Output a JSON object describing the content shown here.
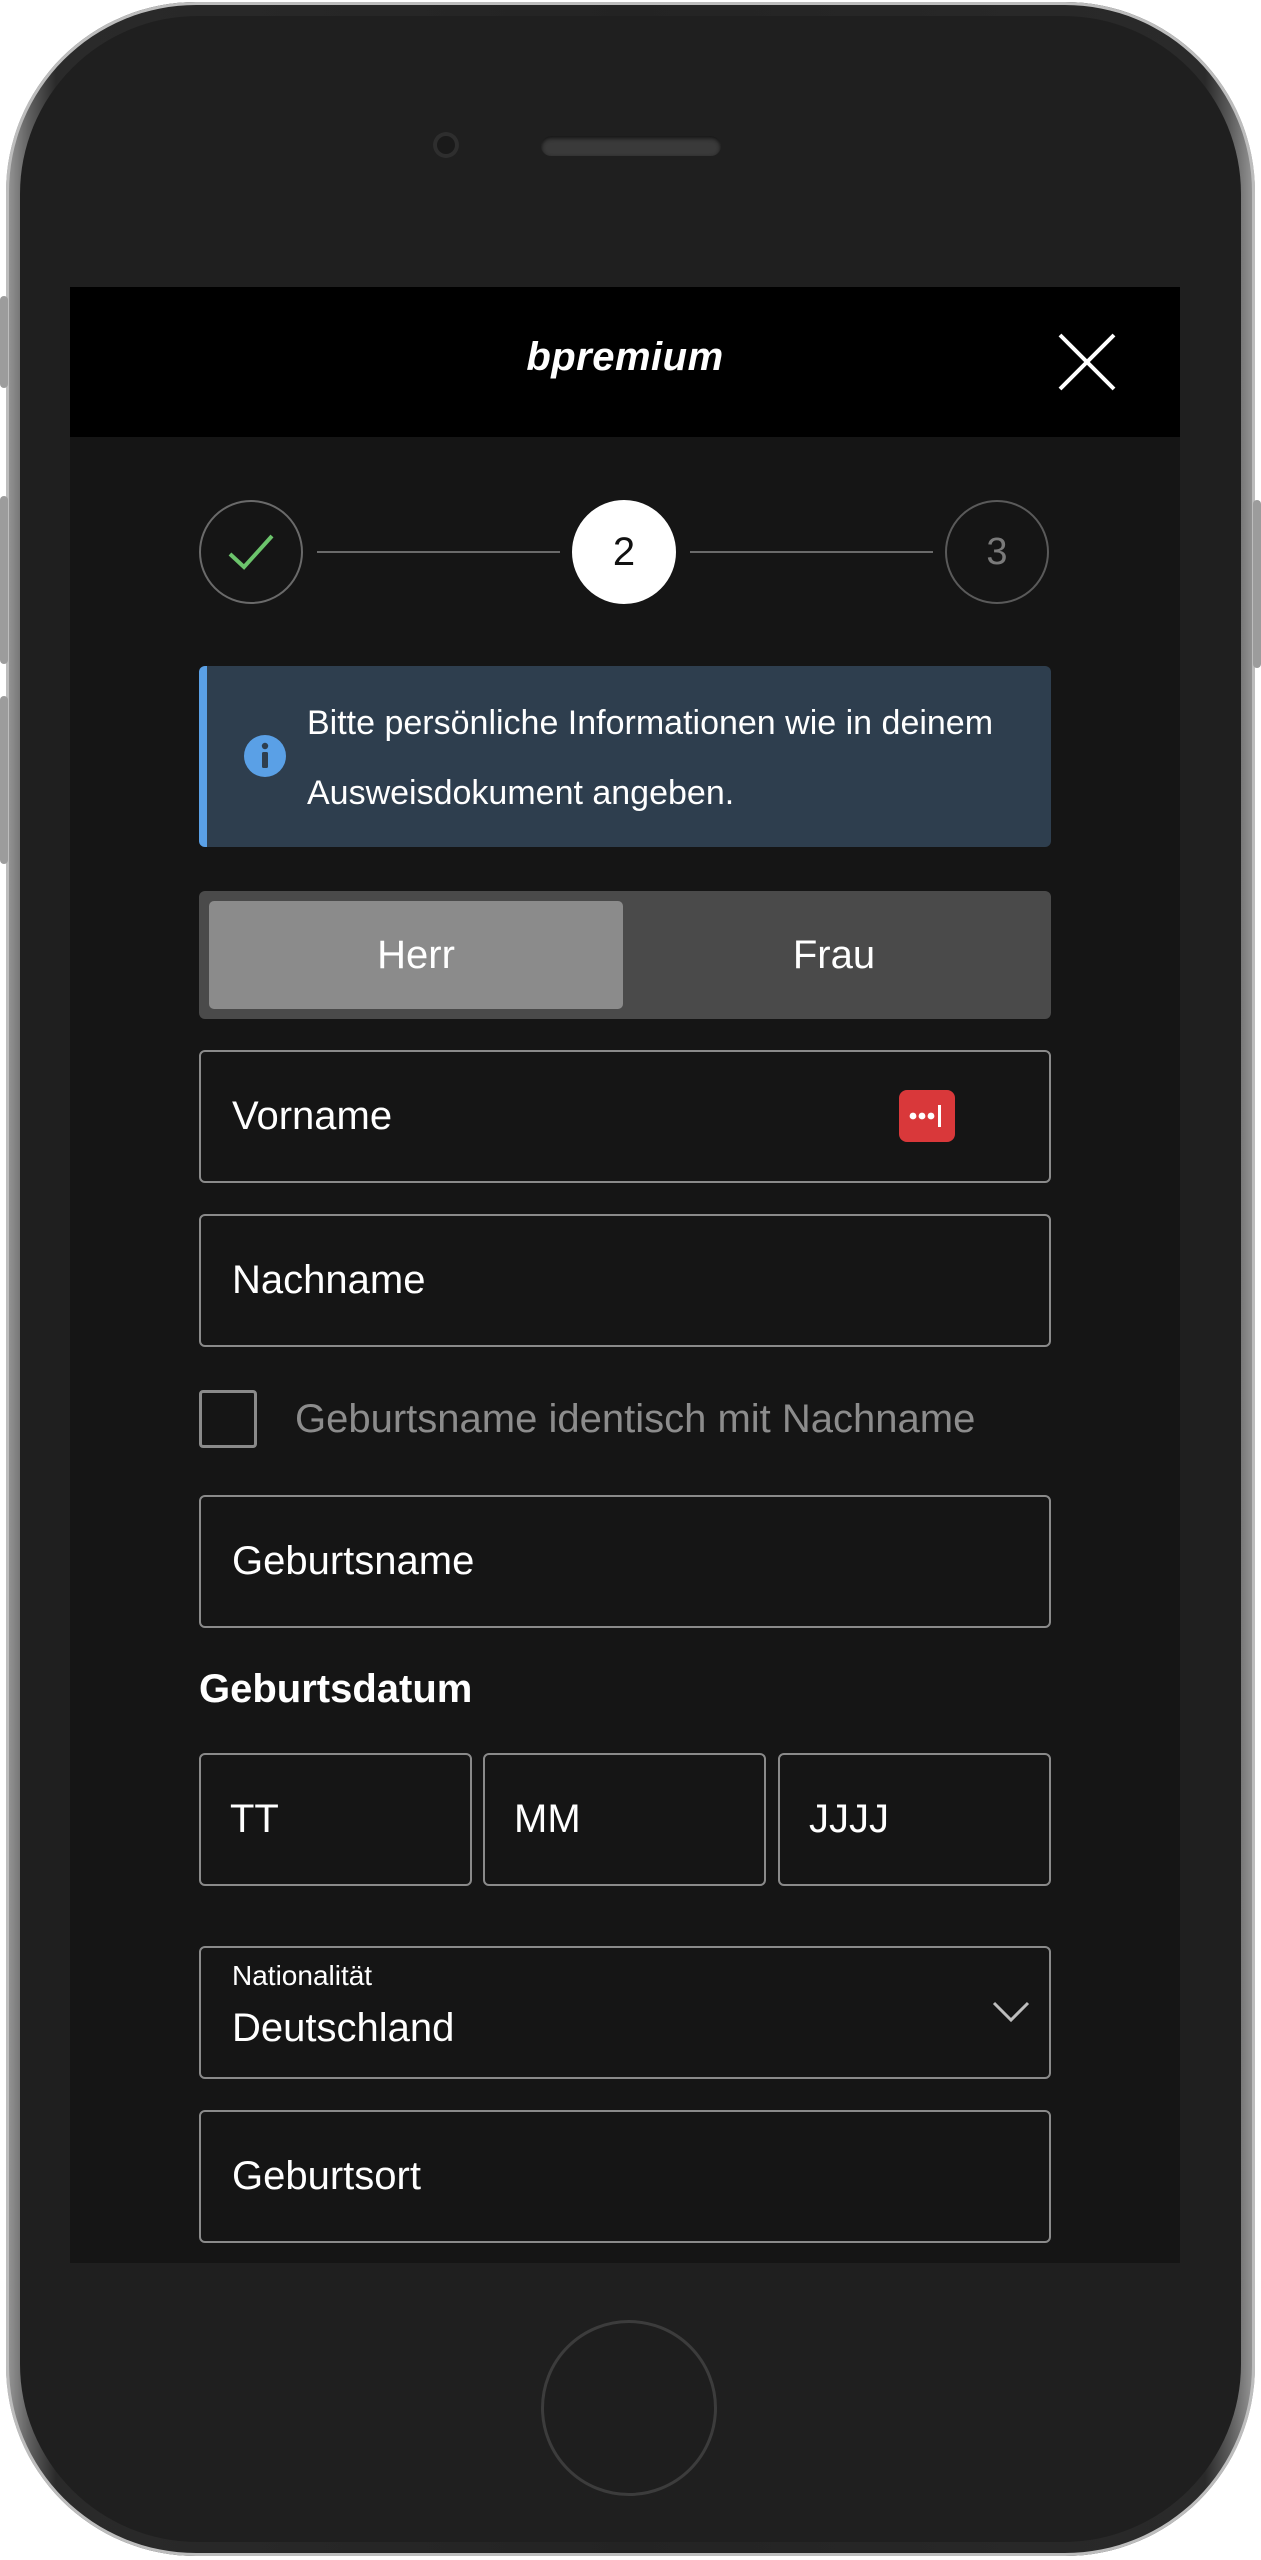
{
  "app": {
    "brand": "bpremium"
  },
  "steps": [
    {
      "status": "done",
      "label": ""
    },
    {
      "status": "active",
      "label": "2"
    },
    {
      "status": "todo",
      "label": "3"
    }
  ],
  "info": {
    "text": "Bitte persönliche Informationen wie in deinem Ausweisdokument angeben."
  },
  "gender": {
    "options": [
      "Herr",
      "Frau"
    ],
    "selected": "Herr"
  },
  "form": {
    "first_name_placeholder": "Vorname",
    "last_name_placeholder": "Nachname",
    "birthname_same_label": "Geburtsname identisch mit Nachname",
    "birthname_same_checked": false,
    "birthname_placeholder": "Geburtsname",
    "birthdate_label": "Geburtsdatum",
    "day_placeholder": "TT",
    "month_placeholder": "MM",
    "year_placeholder": "JJJJ",
    "nationality_label": "Nationalität",
    "nationality_value": "Deutschland",
    "birthplace_placeholder": "Geburtsort"
  },
  "colors": {
    "background": "#151515",
    "topbar": "#000000",
    "info_bg": "#2e3e4e",
    "info_accent": "#5aa0e6",
    "check_green": "#6cc46c",
    "password_manager_red": "#d9383a"
  }
}
